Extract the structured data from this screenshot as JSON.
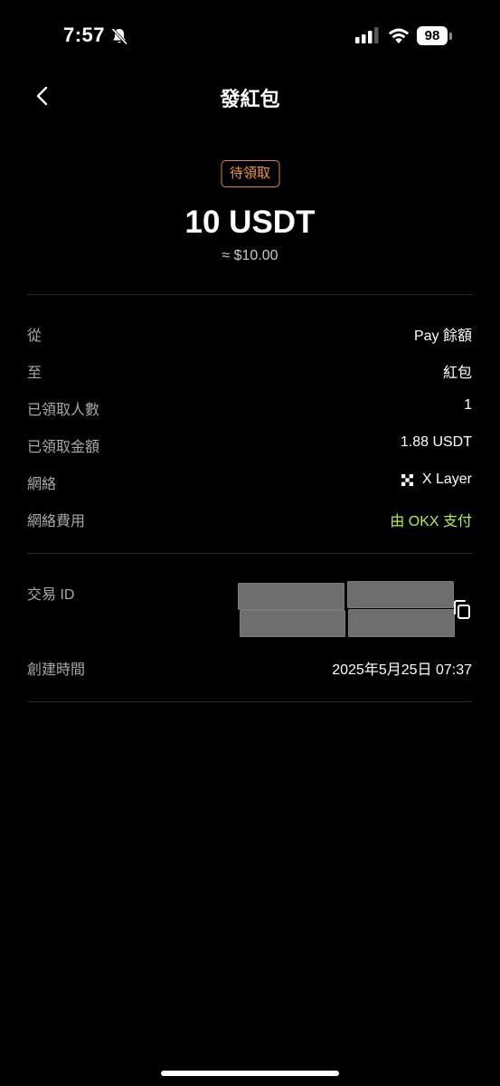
{
  "status_bar": {
    "time": "7:57",
    "battery": "98"
  },
  "nav": {
    "title": "發紅包"
  },
  "summary": {
    "status_badge": "待領取",
    "amount": "10 USDT",
    "fiat_amount": "≈ $10.00"
  },
  "details": {
    "from_label": "從",
    "from_value": "Pay 餘額",
    "to_label": "至",
    "to_value": "紅包",
    "claimed_count_label": "已領取人數",
    "claimed_count_value": "1",
    "claimed_amount_label": "已領取金額",
    "claimed_amount_value": "1.88 USDT",
    "network_label": "網絡",
    "network_value": "X Layer",
    "network_fee_label": "網絡費用",
    "network_fee_value": "由 OKX 支付"
  },
  "transaction": {
    "tx_id_label": "交易 ID",
    "created_label": "創建時間",
    "created_value": "2025年5月25日 07:37"
  },
  "colors": {
    "background": "#000000",
    "badge": "#f09a3a",
    "fee_green": "#b6f03c"
  }
}
